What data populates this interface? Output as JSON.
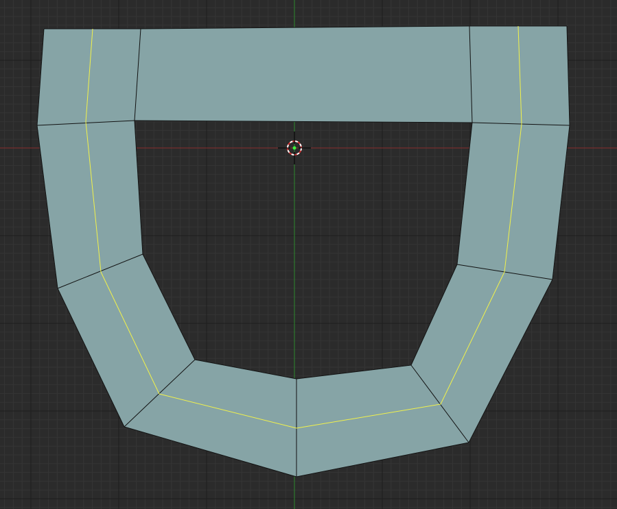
{
  "viewport": {
    "view": "top-orthographic",
    "mode": "edit",
    "background_color": "#2b2b2b",
    "grid": {
      "minor_color": "#353535",
      "major_color": "#1e1e1e"
    },
    "axes": {
      "x_axis_color": "#8a2c2c",
      "y_axis_color": "#2c8a2c"
    }
  },
  "mesh": {
    "face_color": "#86a4a6",
    "edge_color": "#111111",
    "selected_edge_color": "#f2f24a",
    "face_count": 8,
    "selected_edge_loop": "center-loop",
    "selected_edge_count": 7
  },
  "cursor_3d": {
    "icon": "3d-cursor-icon",
    "ring_colors": [
      "#ffffff",
      "#d23232"
    ],
    "origin_color": "#3cf03c"
  }
}
